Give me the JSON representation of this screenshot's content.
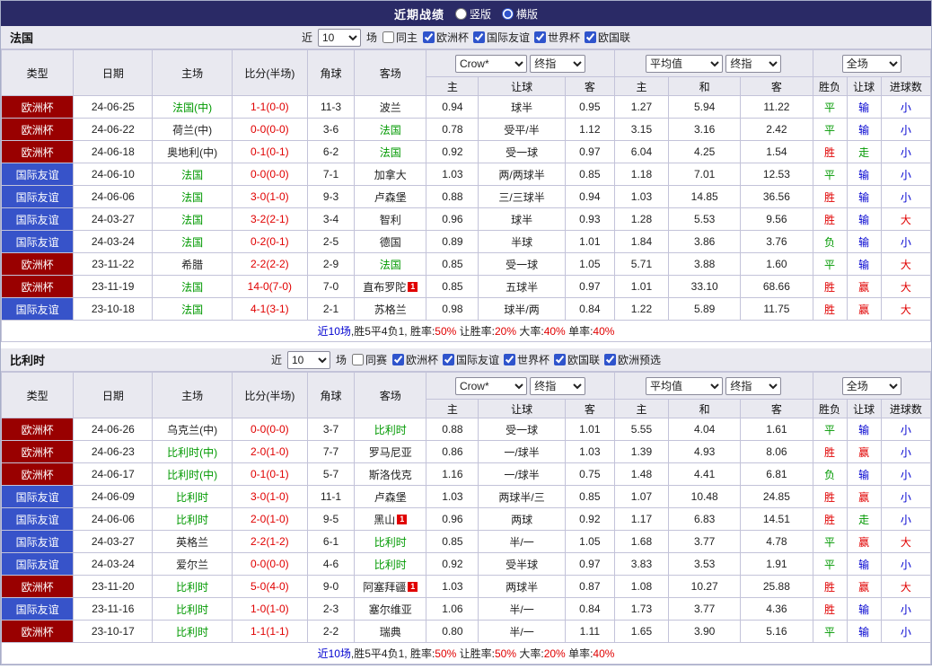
{
  "palette": {
    "topbar": "#2a2a66",
    "header_bg": "#e9e9f0",
    "border": "#c3c3d9",
    "type_red": "#990000",
    "type_blue": "#3753c9",
    "red": "#e00000",
    "green": "#009900",
    "blue": "#0000d0",
    "dark": "#222222",
    "score": "#e00000",
    "accent": "#2f54cc"
  },
  "header": {
    "title": "近期战绩",
    "radio_vertical": "竖版",
    "radio_horizontal": "横版"
  },
  "labels": {
    "near": "近",
    "games": "场"
  },
  "columns": {
    "type": "类型",
    "date": "日期",
    "home": "主场",
    "score": "比分(半场)",
    "corner": "角球",
    "away": "客场",
    "sel_provider": "Crow*",
    "sel_final": "终指",
    "sel_avg": "平均值",
    "sel_scope": "全场",
    "sub": [
      "主",
      "让球",
      "客",
      "主",
      "和",
      "客",
      "胜负",
      "让球",
      "进球数"
    ]
  },
  "sections": [
    {
      "name": "法国",
      "filter": {
        "count": "10",
        "same": "同主",
        "comps": [
          "欧洲杯",
          "国际友谊",
          "世界杯",
          "欧国联"
        ]
      },
      "rows": [
        {
          "type": "欧洲杯",
          "tc": "red",
          "date": "24-06-25",
          "home": "法国(中)",
          "hc": "green",
          "score": "1-1(0-0)",
          "corner": "11-3",
          "away": "波兰",
          "ac": "dark",
          "o": [
            "0.94",
            "球半",
            "0.95",
            "1.27",
            "5.94",
            "11.22"
          ],
          "res": [
            [
              "平",
              "green"
            ],
            [
              "输",
              "blue"
            ],
            [
              "小",
              "blue"
            ]
          ]
        },
        {
          "type": "欧洲杯",
          "tc": "red",
          "date": "24-06-22",
          "home": "荷兰(中)",
          "hc": "dark",
          "score": "0-0(0-0)",
          "corner": "3-6",
          "away": "法国",
          "ac": "green",
          "o": [
            "0.78",
            "受平/半",
            "1.12",
            "3.15",
            "3.16",
            "2.42"
          ],
          "res": [
            [
              "平",
              "green"
            ],
            [
              "输",
              "blue"
            ],
            [
              "小",
              "blue"
            ]
          ]
        },
        {
          "type": "欧洲杯",
          "tc": "red",
          "date": "24-06-18",
          "home": "奥地利(中)",
          "hc": "dark",
          "score": "0-1(0-1)",
          "corner": "6-2",
          "away": "法国",
          "ac": "green",
          "o": [
            "0.92",
            "受一球",
            "0.97",
            "6.04",
            "4.25",
            "1.54"
          ],
          "res": [
            [
              "胜",
              "red"
            ],
            [
              "走",
              "green"
            ],
            [
              "小",
              "blue"
            ]
          ]
        },
        {
          "type": "国际友谊",
          "tc": "blue",
          "date": "24-06-10",
          "home": "法国",
          "hc": "green",
          "score": "0-0(0-0)",
          "corner": "7-1",
          "away": "加拿大",
          "ac": "dark",
          "o": [
            "1.03",
            "两/两球半",
            "0.85",
            "1.18",
            "7.01",
            "12.53"
          ],
          "res": [
            [
              "平",
              "green"
            ],
            [
              "输",
              "blue"
            ],
            [
              "小",
              "blue"
            ]
          ]
        },
        {
          "type": "国际友谊",
          "tc": "blue",
          "date": "24-06-06",
          "home": "法国",
          "hc": "green",
          "score": "3-0(1-0)",
          "corner": "9-3",
          "away": "卢森堡",
          "ac": "dark",
          "o": [
            "0.88",
            "三/三球半",
            "0.94",
            "1.03",
            "14.85",
            "36.56"
          ],
          "res": [
            [
              "胜",
              "red"
            ],
            [
              "输",
              "blue"
            ],
            [
              "小",
              "blue"
            ]
          ]
        },
        {
          "type": "国际友谊",
          "tc": "blue",
          "date": "24-03-27",
          "home": "法国",
          "hc": "green",
          "score": "3-2(2-1)",
          "corner": "3-4",
          "away": "智利",
          "ac": "dark",
          "o": [
            "0.96",
            "球半",
            "0.93",
            "1.28",
            "5.53",
            "9.56"
          ],
          "res": [
            [
              "胜",
              "red"
            ],
            [
              "输",
              "blue"
            ],
            [
              "大",
              "red"
            ]
          ]
        },
        {
          "type": "国际友谊",
          "tc": "blue",
          "date": "24-03-24",
          "home": "法国",
          "hc": "green",
          "score": "0-2(0-1)",
          "corner": "2-5",
          "away": "德国",
          "ac": "dark",
          "o": [
            "0.89",
            "半球",
            "1.01",
            "1.84",
            "3.86",
            "3.76"
          ],
          "res": [
            [
              "负",
              "green"
            ],
            [
              "输",
              "blue"
            ],
            [
              "小",
              "blue"
            ]
          ]
        },
        {
          "type": "欧洲杯",
          "tc": "red",
          "date": "23-11-22",
          "home": "希腊",
          "hc": "dark",
          "score": "2-2(2-2)",
          "corner": "2-9",
          "away": "法国",
          "ac": "green",
          "o": [
            "0.85",
            "受一球",
            "1.05",
            "5.71",
            "3.88",
            "1.60"
          ],
          "res": [
            [
              "平",
              "green"
            ],
            [
              "输",
              "blue"
            ],
            [
              "大",
              "red"
            ]
          ]
        },
        {
          "type": "欧洲杯",
          "tc": "red",
          "date": "23-11-19",
          "home": "法国",
          "hc": "green",
          "score": "14-0(7-0)",
          "corner": "7-0",
          "away": "直布罗陀",
          "ac": "dark",
          "arc": true,
          "o": [
            "0.85",
            "五球半",
            "0.97",
            "1.01",
            "33.10",
            "68.66"
          ],
          "res": [
            [
              "胜",
              "red"
            ],
            [
              "赢",
              "red"
            ],
            [
              "大",
              "red"
            ]
          ]
        },
        {
          "type": "国际友谊",
          "tc": "blue",
          "date": "23-10-18",
          "home": "法国",
          "hc": "green",
          "score": "4-1(3-1)",
          "corner": "2-1",
          "away": "苏格兰",
          "ac": "dark",
          "o": [
            "0.98",
            "球半/两",
            "0.84",
            "1.22",
            "5.89",
            "11.75"
          ],
          "res": [
            [
              "胜",
              "red"
            ],
            [
              "赢",
              "red"
            ],
            [
              "大",
              "red"
            ]
          ]
        }
      ],
      "summary": [
        [
          "近10场",
          "blue"
        ],
        [
          ",胜5平4负1, ",
          "dark"
        ],
        [
          "胜率:",
          "dark"
        ],
        [
          "50%",
          "red"
        ],
        [
          " 让胜率:",
          "dark"
        ],
        [
          "20%",
          "red"
        ],
        [
          " 大率:",
          "dark"
        ],
        [
          "40%",
          "red"
        ],
        [
          " 单率:",
          "dark"
        ],
        [
          "40%",
          "red"
        ]
      ]
    },
    {
      "name": "比利时",
      "filter": {
        "count": "10",
        "same": "同赛",
        "comps": [
          "欧洲杯",
          "国际友谊",
          "世界杯",
          "欧国联",
          "欧洲预选"
        ]
      },
      "rows": [
        {
          "type": "欧洲杯",
          "tc": "red",
          "date": "24-06-26",
          "home": "乌克兰(中)",
          "hc": "dark",
          "score": "0-0(0-0)",
          "corner": "3-7",
          "away": "比利时",
          "ac": "green",
          "o": [
            "0.88",
            "受一球",
            "1.01",
            "5.55",
            "4.04",
            "1.61"
          ],
          "res": [
            [
              "平",
              "green"
            ],
            [
              "输",
              "blue"
            ],
            [
              "小",
              "blue"
            ]
          ]
        },
        {
          "type": "欧洲杯",
          "tc": "red",
          "date": "24-06-23",
          "home": "比利时(中)",
          "hc": "green",
          "score": "2-0(1-0)",
          "corner": "7-7",
          "away": "罗马尼亚",
          "ac": "dark",
          "o": [
            "0.86",
            "一/球半",
            "1.03",
            "1.39",
            "4.93",
            "8.06"
          ],
          "res": [
            [
              "胜",
              "red"
            ],
            [
              "赢",
              "red"
            ],
            [
              "小",
              "blue"
            ]
          ]
        },
        {
          "type": "欧洲杯",
          "tc": "red",
          "date": "24-06-17",
          "home": "比利时(中)",
          "hc": "green",
          "score": "0-1(0-1)",
          "corner": "5-7",
          "away": "斯洛伐克",
          "ac": "dark",
          "o": [
            "1.16",
            "一/球半",
            "0.75",
            "1.48",
            "4.41",
            "6.81"
          ],
          "res": [
            [
              "负",
              "green"
            ],
            [
              "输",
              "blue"
            ],
            [
              "小",
              "blue"
            ]
          ]
        },
        {
          "type": "国际友谊",
          "tc": "blue",
          "date": "24-06-09",
          "home": "比利时",
          "hc": "green",
          "score": "3-0(1-0)",
          "corner": "11-1",
          "away": "卢森堡",
          "ac": "dark",
          "o": [
            "1.03",
            "两球半/三",
            "0.85",
            "1.07",
            "10.48",
            "24.85"
          ],
          "res": [
            [
              "胜",
              "red"
            ],
            [
              "赢",
              "red"
            ],
            [
              "小",
              "blue"
            ]
          ]
        },
        {
          "type": "国际友谊",
          "tc": "blue",
          "date": "24-06-06",
          "home": "比利时",
          "hc": "green",
          "score": "2-0(1-0)",
          "corner": "9-5",
          "away": "黑山",
          "ac": "dark",
          "arc": true,
          "o": [
            "0.96",
            "两球",
            "0.92",
            "1.17",
            "6.83",
            "14.51"
          ],
          "res": [
            [
              "胜",
              "red"
            ],
            [
              "走",
              "green"
            ],
            [
              "小",
              "blue"
            ]
          ]
        },
        {
          "type": "国际友谊",
          "tc": "blue",
          "date": "24-03-27",
          "home": "英格兰",
          "hc": "dark",
          "score": "2-2(1-2)",
          "corner": "6-1",
          "away": "比利时",
          "ac": "green",
          "o": [
            "0.85",
            "半/一",
            "1.05",
            "1.68",
            "3.77",
            "4.78"
          ],
          "res": [
            [
              "平",
              "green"
            ],
            [
              "赢",
              "red"
            ],
            [
              "大",
              "red"
            ]
          ]
        },
        {
          "type": "国际友谊",
          "tc": "blue",
          "date": "24-03-24",
          "home": "爱尔兰",
          "hc": "dark",
          "score": "0-0(0-0)",
          "corner": "4-6",
          "away": "比利时",
          "ac": "green",
          "o": [
            "0.92",
            "受半球",
            "0.97",
            "3.83",
            "3.53",
            "1.91"
          ],
          "res": [
            [
              "平",
              "green"
            ],
            [
              "输",
              "blue"
            ],
            [
              "小",
              "blue"
            ]
          ]
        },
        {
          "type": "欧洲杯",
          "tc": "red",
          "date": "23-11-20",
          "home": "比利时",
          "hc": "green",
          "score": "5-0(4-0)",
          "corner": "9-0",
          "away": "阿塞拜疆",
          "ac": "dark",
          "arc": true,
          "o": [
            "1.03",
            "两球半",
            "0.87",
            "1.08",
            "10.27",
            "25.88"
          ],
          "res": [
            [
              "胜",
              "red"
            ],
            [
              "赢",
              "red"
            ],
            [
              "大",
              "red"
            ]
          ]
        },
        {
          "type": "国际友谊",
          "tc": "blue",
          "date": "23-11-16",
          "home": "比利时",
          "hc": "green",
          "score": "1-0(1-0)",
          "corner": "2-3",
          "away": "塞尔维亚",
          "ac": "dark",
          "o": [
            "1.06",
            "半/一",
            "0.84",
            "1.73",
            "3.77",
            "4.36"
          ],
          "res": [
            [
              "胜",
              "red"
            ],
            [
              "输",
              "blue"
            ],
            [
              "小",
              "blue"
            ]
          ]
        },
        {
          "type": "欧洲杯",
          "tc": "red",
          "date": "23-10-17",
          "home": "比利时",
          "hc": "green",
          "score": "1-1(1-1)",
          "corner": "2-2",
          "away": "瑞典",
          "ac": "dark",
          "o": [
            "0.80",
            "半/一",
            "1.11",
            "1.65",
            "3.90",
            "5.16"
          ],
          "res": [
            [
              "平",
              "green"
            ],
            [
              "输",
              "blue"
            ],
            [
              "小",
              "blue"
            ]
          ]
        }
      ],
      "summary": [
        [
          "近10场",
          "blue"
        ],
        [
          ",胜5平4负1, ",
          "dark"
        ],
        [
          "胜率:",
          "dark"
        ],
        [
          "50%",
          "red"
        ],
        [
          " 让胜率:",
          "dark"
        ],
        [
          "50%",
          "red"
        ],
        [
          " 大率:",
          "dark"
        ],
        [
          "20%",
          "red"
        ],
        [
          " 单率:",
          "dark"
        ],
        [
          "40%",
          "red"
        ]
      ]
    }
  ]
}
